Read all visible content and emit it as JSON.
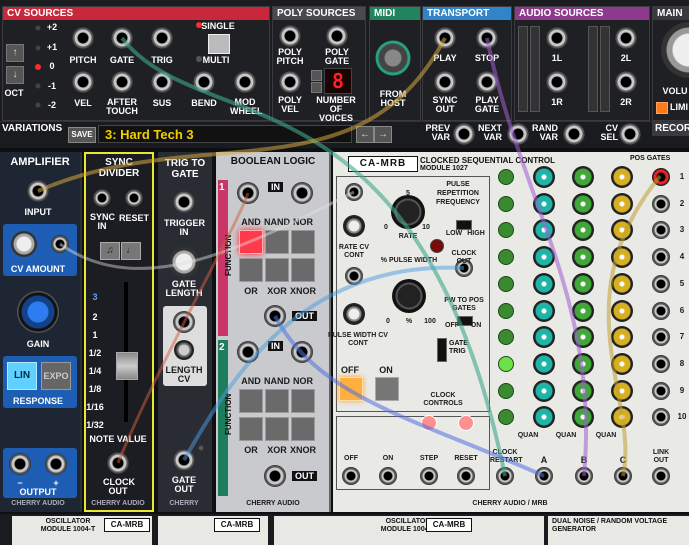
{
  "top": {
    "cv_sources": {
      "title": "CV SOURCES",
      "oct": "OCT",
      "oct_values": [
        "+2",
        "+1",
        "0",
        "-1",
        "-2"
      ],
      "pitch": "PITCH",
      "gate": "GATE",
      "trig": "TRIG",
      "single": "SINGLE",
      "multi": "MULTI",
      "vel": "VEL",
      "after_touch": "AFTER TOUCH",
      "sus": "SUS",
      "bend": "BEND",
      "mod_wheel": "MOD WHEEL"
    },
    "poly_sources": {
      "title": "POLY SOURCES",
      "poly_pitch": "POLY PITCH",
      "poly_gate": "POLY GATE",
      "poly_vel": "POLY VEL",
      "num_voices": "NUMBER OF VOICES",
      "voices_value": "8"
    },
    "midi": {
      "title": "MIDI",
      "from_host": "FROM HOST"
    },
    "transport": {
      "title": "TRANSPORT",
      "play": "PLAY",
      "stop": "STOP",
      "sync_out": "SYNC OUT",
      "play_gate": "PLAY GATE"
    },
    "audio_sources": {
      "title": "AUDIO SOURCES",
      "l1": "1L",
      "l2": "2L",
      "r1": "1R",
      "r2": "2R"
    },
    "main": {
      "title": "MAIN O",
      "volume": "VOLU",
      "limit": "LIMI"
    },
    "variations": {
      "title": "VARIATIONS",
      "save": "SAVE",
      "current": "3: Hard Tech 3",
      "prev": "PREV VAR",
      "next": "NEXT VAR",
      "rand": "RAND VAR",
      "cv_sel": "CV SEL",
      "record": "RECOR"
    }
  },
  "amplifier": {
    "title": "AMPLIFIER",
    "input": "INPUT",
    "cv_amount": "CV AMOUNT",
    "gain": "GAIN",
    "lin": "LIN",
    "expo": "EXPO",
    "response": "RESPONSE",
    "output": "OUTPUT",
    "minus": "−",
    "plus": "+",
    "brand": "CHERRY AUDIO"
  },
  "sync_divider": {
    "title": "SYNC DIVIDER",
    "sync_in": "SYNC IN",
    "reset": "RESET",
    "values": [
      "3",
      "2",
      "1",
      "1/2",
      "1/4",
      "1/8",
      "1/16",
      "1/32"
    ],
    "note_value": "NOTE VALUE",
    "clock_out": "CLOCK OUT",
    "brand": "CHERRY AUDIO"
  },
  "trig_to_gate": {
    "title": "TRIG TO GATE",
    "trigger_in": "TRIGGER IN",
    "gate_length": "GATE LENGTH",
    "length_cv": "LENGTH CV",
    "gate_out": "GATE OUT",
    "brand": "CHERRY"
  },
  "boolean_logic": {
    "title": "BOOLEAN LOGIC",
    "in": "IN",
    "and": "AND",
    "nand": "NAND",
    "nor": "NOR",
    "or": "OR",
    "xor": "XOR",
    "xnor": "XNOR",
    "function": "FUNCTION",
    "out": "OUT",
    "one": "1",
    "two": "2",
    "brand": "CHERRY AUDIO"
  },
  "clocked_seq": {
    "brand": "CA-MRB",
    "title": "CLOCKED SEQUENTIAL CONTROL",
    "model": "MODULE 1027",
    "pulse_freq": "PULSE REPETITION FREQUENCY",
    "low": "LOW",
    "high": "HIGH",
    "rate": "RATE",
    "rate_cv": "RATE CV CONT",
    "pct_pulse_width": "% PULSE WIDTH",
    "pw_cv": "PULSE WIDTH CV CONT",
    "clock_out": "CLOCK OUT",
    "pw_to_pos": "PW TO POS GATES",
    "off": "OFF",
    "on": "ON",
    "gate_trig": "GATE TRIG",
    "clock_controls": "CLOCK CONTROLS",
    "step": "STEP",
    "reset": "RESET",
    "clock_restart": "CLOCK RESTART",
    "a": "A",
    "b": "B",
    "c": "C",
    "quan": "QUAN",
    "link_out": "LINK OUT",
    "pos_gates": "POS GATES",
    "rows": [
      "1",
      "2",
      "3",
      "4",
      "5",
      "6",
      "7",
      "8",
      "9",
      "10"
    ],
    "footer": "CHERRY AUDIO / MRB",
    "scale": [
      "0",
      "5",
      "10"
    ],
    "scale_pct": [
      "0",
      "%",
      "100"
    ]
  },
  "bottom": {
    "osc1": "OSCILLATOR MODULE 1004-T",
    "osc2": "OSCILLATOR MODULE 1004-T",
    "camrb": "CA-MRB",
    "noise": "DUAL NOISE / RANDOM VOLTAGE GENERATOR"
  }
}
